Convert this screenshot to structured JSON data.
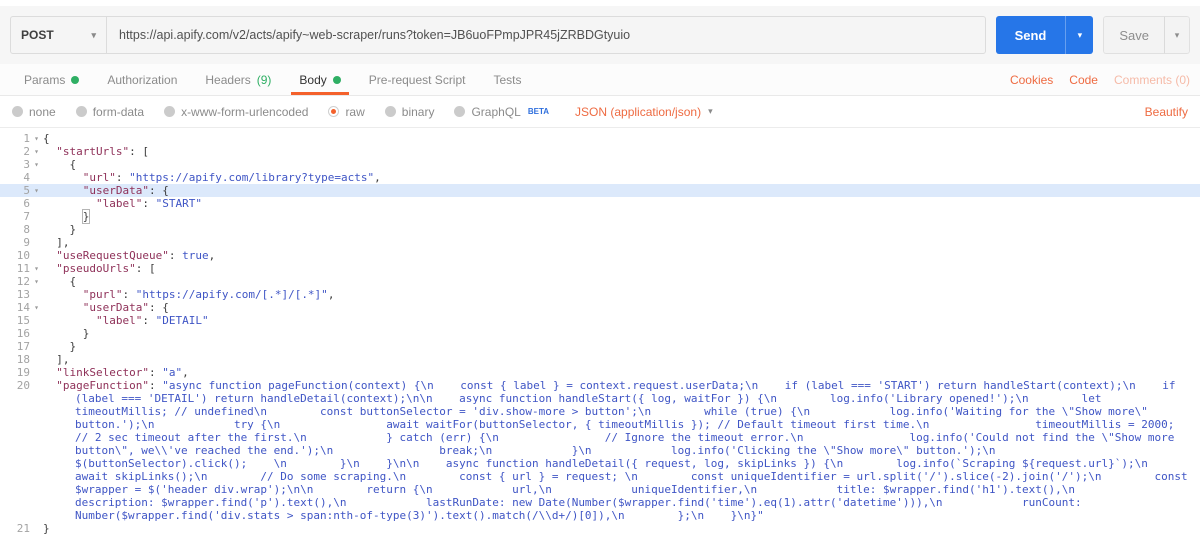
{
  "colors": {
    "accent_orange": "#f4612c",
    "link_orange": "#ee6b42",
    "send_blue": "#2676e8",
    "beta_blue": "#2f6fdd",
    "green": "#2faf64",
    "editor_key": "#8f3159",
    "editor_string": "#3f55c5",
    "editor_atom": "#3f55c5",
    "line_highlight": "#dce9fb"
  },
  "request_bar": {
    "method": "POST",
    "url": "https://api.apify.com/v2/acts/apify~web-scraper/runs?token=JB6uoFPmpJPR45jZRBDGtyuio",
    "send_label": "Send",
    "save_label": "Save"
  },
  "tabs": {
    "items": [
      {
        "label": "Params",
        "dot": true,
        "active": false
      },
      {
        "label": "Authorization",
        "dot": false,
        "active": false
      },
      {
        "label": "Headers",
        "count": "(9)",
        "dot": false,
        "active": false
      },
      {
        "label": "Body",
        "dot": true,
        "active": true
      },
      {
        "label": "Pre-request Script",
        "dot": false,
        "active": false
      },
      {
        "label": "Tests",
        "dot": false,
        "active": false
      }
    ],
    "right_links": [
      {
        "label": "Cookies",
        "muted": false
      },
      {
        "label": "Code",
        "muted": false
      },
      {
        "label": "Comments (0)",
        "muted": true
      }
    ]
  },
  "body_modes": {
    "options": [
      {
        "label": "none",
        "selected": false
      },
      {
        "label": "form-data",
        "selected": false
      },
      {
        "label": "x-www-form-urlencoded",
        "selected": false
      },
      {
        "label": "raw",
        "selected": true
      },
      {
        "label": "binary",
        "selected": false
      },
      {
        "label": "GraphQL",
        "badge": "BETA",
        "selected": false
      }
    ],
    "content_type": "JSON (application/json)",
    "beautify_label": "Beautify"
  },
  "editor": {
    "lines": [
      {
        "num": 1,
        "fold": true,
        "tokens": [
          [
            "p",
            "{"
          ]
        ]
      },
      {
        "num": 2,
        "fold": true,
        "tokens": [
          [
            "p",
            "  "
          ],
          [
            "k",
            "\"startUrls\""
          ],
          [
            "p",
            ": ["
          ]
        ]
      },
      {
        "num": 3,
        "fold": true,
        "tokens": [
          [
            "p",
            "    {"
          ]
        ]
      },
      {
        "num": 4,
        "tokens": [
          [
            "p",
            "      "
          ],
          [
            "k",
            "\"url\""
          ],
          [
            "p",
            ": "
          ],
          [
            "s",
            "\"https://apify.com/library?type=acts\""
          ],
          [
            "p",
            ","
          ]
        ]
      },
      {
        "num": 5,
        "fold": true,
        "hl": true,
        "tokens": [
          [
            "p",
            "      "
          ],
          [
            "k",
            "\"userData\""
          ],
          [
            "p",
            ": {"
          ]
        ]
      },
      {
        "num": 6,
        "tokens": [
          [
            "p",
            "        "
          ],
          [
            "k",
            "\"label\""
          ],
          [
            "p",
            ": "
          ],
          [
            "s",
            "\"START\""
          ]
        ]
      },
      {
        "num": 7,
        "tokens": [
          [
            "p",
            "      "
          ],
          [
            "box",
            "}"
          ]
        ]
      },
      {
        "num": 8,
        "tokens": [
          [
            "p",
            "    }"
          ]
        ]
      },
      {
        "num": 9,
        "tokens": [
          [
            "p",
            "  ],"
          ]
        ]
      },
      {
        "num": 10,
        "tokens": [
          [
            "p",
            "  "
          ],
          [
            "k",
            "\"useRequestQueue\""
          ],
          [
            "p",
            ": "
          ],
          [
            "b",
            "true"
          ],
          [
            "p",
            ","
          ]
        ]
      },
      {
        "num": 11,
        "fold": true,
        "tokens": [
          [
            "p",
            "  "
          ],
          [
            "k",
            "\"pseudoUrls\""
          ],
          [
            "p",
            ": ["
          ]
        ]
      },
      {
        "num": 12,
        "fold": true,
        "tokens": [
          [
            "p",
            "    {"
          ]
        ]
      },
      {
        "num": 13,
        "tokens": [
          [
            "p",
            "      "
          ],
          [
            "k",
            "\"purl\""
          ],
          [
            "p",
            ": "
          ],
          [
            "s",
            "\"https://apify.com/[.*]/[.*]\""
          ],
          [
            "p",
            ","
          ]
        ]
      },
      {
        "num": 14,
        "fold": true,
        "tokens": [
          [
            "p",
            "      "
          ],
          [
            "k",
            "\"userData\""
          ],
          [
            "p",
            ": {"
          ]
        ]
      },
      {
        "num": 15,
        "tokens": [
          [
            "p",
            "        "
          ],
          [
            "k",
            "\"label\""
          ],
          [
            "p",
            ": "
          ],
          [
            "s",
            "\"DETAIL\""
          ]
        ]
      },
      {
        "num": 16,
        "tokens": [
          [
            "p",
            "      }"
          ]
        ]
      },
      {
        "num": 17,
        "tokens": [
          [
            "p",
            "    }"
          ]
        ]
      },
      {
        "num": 18,
        "tokens": [
          [
            "p",
            "  ],"
          ]
        ]
      },
      {
        "num": 19,
        "tokens": [
          [
            "p",
            "  "
          ],
          [
            "k",
            "\"linkSelector\""
          ],
          [
            "p",
            ": "
          ],
          [
            "s",
            "\"a\""
          ],
          [
            "p",
            ","
          ]
        ]
      },
      {
        "num": 20,
        "tokens": [
          [
            "p",
            "  "
          ],
          [
            "k",
            "\"pageFunction\""
          ],
          [
            "p",
            ": "
          ],
          [
            "s",
            "\"async function pageFunction(context) {\\n    const { label } = context.request.userData;\\n    if (label === 'START') return handleStart(context);\\n    if (label === 'DETAIL') return handleDetail(context);\\n\\n    async function handleStart({ log, waitFor }) {\\n        log.info('Library opened!');\\n        let timeoutMillis; // undefined\\n        const buttonSelector = 'div.show-more > button';\\n        while (true) {\\n            log.info('Waiting for the \\\"Show more\\\" button.');\\n            try {\\n                await waitFor(buttonSelector, { timeoutMillis }); // Default timeout first time.\\n                timeoutMillis = 2000; // 2 sec timeout after the first.\\n            } catch (err) {\\n                // Ignore the timeout error.\\n                log.info('Could not find the \\\"Show more button\\\", we\\\\'ve reached the end.');\\n                break;\\n            }\\n            log.info('Clicking the \\\"Show more\\\" button.');\\n            $(buttonSelector).click();    \\n        }\\n    }\\n\\n    async function handleDetail({ request, log, skipLinks }) {\\n        log.info(`Scraping ${request.url}`);\\n        await skipLinks();\\n        // Do some scraping.\\n        const { url } = request; \\n        const uniqueIdentifier = url.split('/').slice(-2).join('/');\\n        const $wrapper = $('header div.wrap');\\n\\n        return {\\n            url,\\n            uniqueIdentifier,\\n            title: $wrapper.find('h1').text(),\\n            description: $wrapper.find('p').text(),\\n            lastRunDate: new Date(Number($wrapper.find('time').eq(1).attr('datetime'))),\\n            runCount: Number($wrapper.find('div.stats > span:nth-of-type(3)').text().match(/\\\\d+/)[0]),\\n        };\\n    }\\n}\""
          ]
        ]
      },
      {
        "num": 21,
        "tokens": [
          [
            "p",
            "}"
          ]
        ]
      }
    ]
  }
}
